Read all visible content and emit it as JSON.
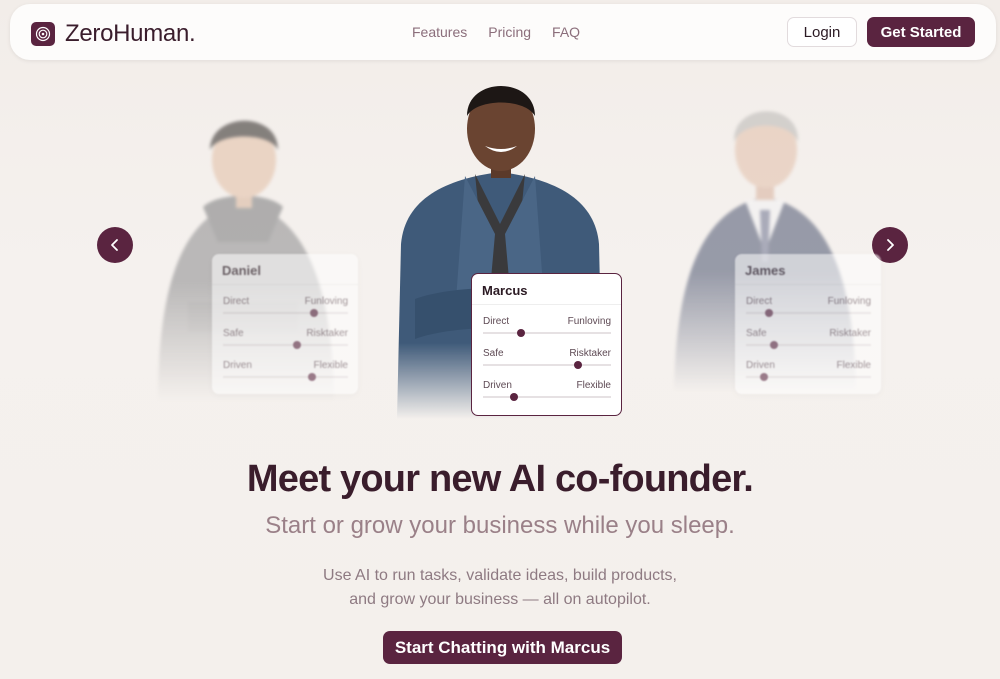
{
  "brand": {
    "name": "ZeroHuman.",
    "icon": "logo-icon"
  },
  "nav": {
    "links": [
      "Features",
      "Pricing",
      "FAQ"
    ],
    "login_label": "Login",
    "get_started_label": "Get Started"
  },
  "colors": {
    "brand": "#5a2440",
    "heading": "#3a1d2c",
    "muted": "#9a8088",
    "background": "#f4f0ec"
  },
  "carousel": {
    "prev_icon": "chevron-left-icon",
    "next_icon": "chevron-right-icon",
    "cofounders": [
      {
        "name": "Daniel",
        "traits": [
          {
            "left": "Direct",
            "right": "Funloving",
            "value": 0.73
          },
          {
            "left": "Safe",
            "right": "Risktaker",
            "value": 0.59
          },
          {
            "left": "Driven",
            "right": "Flexible",
            "value": 0.71
          }
        ]
      },
      {
        "name": "Marcus",
        "traits": [
          {
            "left": "Direct",
            "right": "Funloving",
            "value": 0.3
          },
          {
            "left": "Safe",
            "right": "Risktaker",
            "value": 0.74
          },
          {
            "left": "Driven",
            "right": "Flexible",
            "value": 0.24
          }
        ]
      },
      {
        "name": "James",
        "traits": [
          {
            "left": "Direct",
            "right": "Funloving",
            "value": 0.18
          },
          {
            "left": "Safe",
            "right": "Risktaker",
            "value": 0.22
          },
          {
            "left": "Driven",
            "right": "Flexible",
            "value": 0.14
          }
        ]
      }
    ]
  },
  "hero": {
    "headline": "Meet your new AI co-founder.",
    "subheadline": "Start or grow your business while you sleep.",
    "description_line1": "Use AI to run tasks, validate ideas, build products,",
    "description_line2": "and grow your business — all on autopilot.",
    "cta_label": "Start Chatting with Marcus"
  }
}
